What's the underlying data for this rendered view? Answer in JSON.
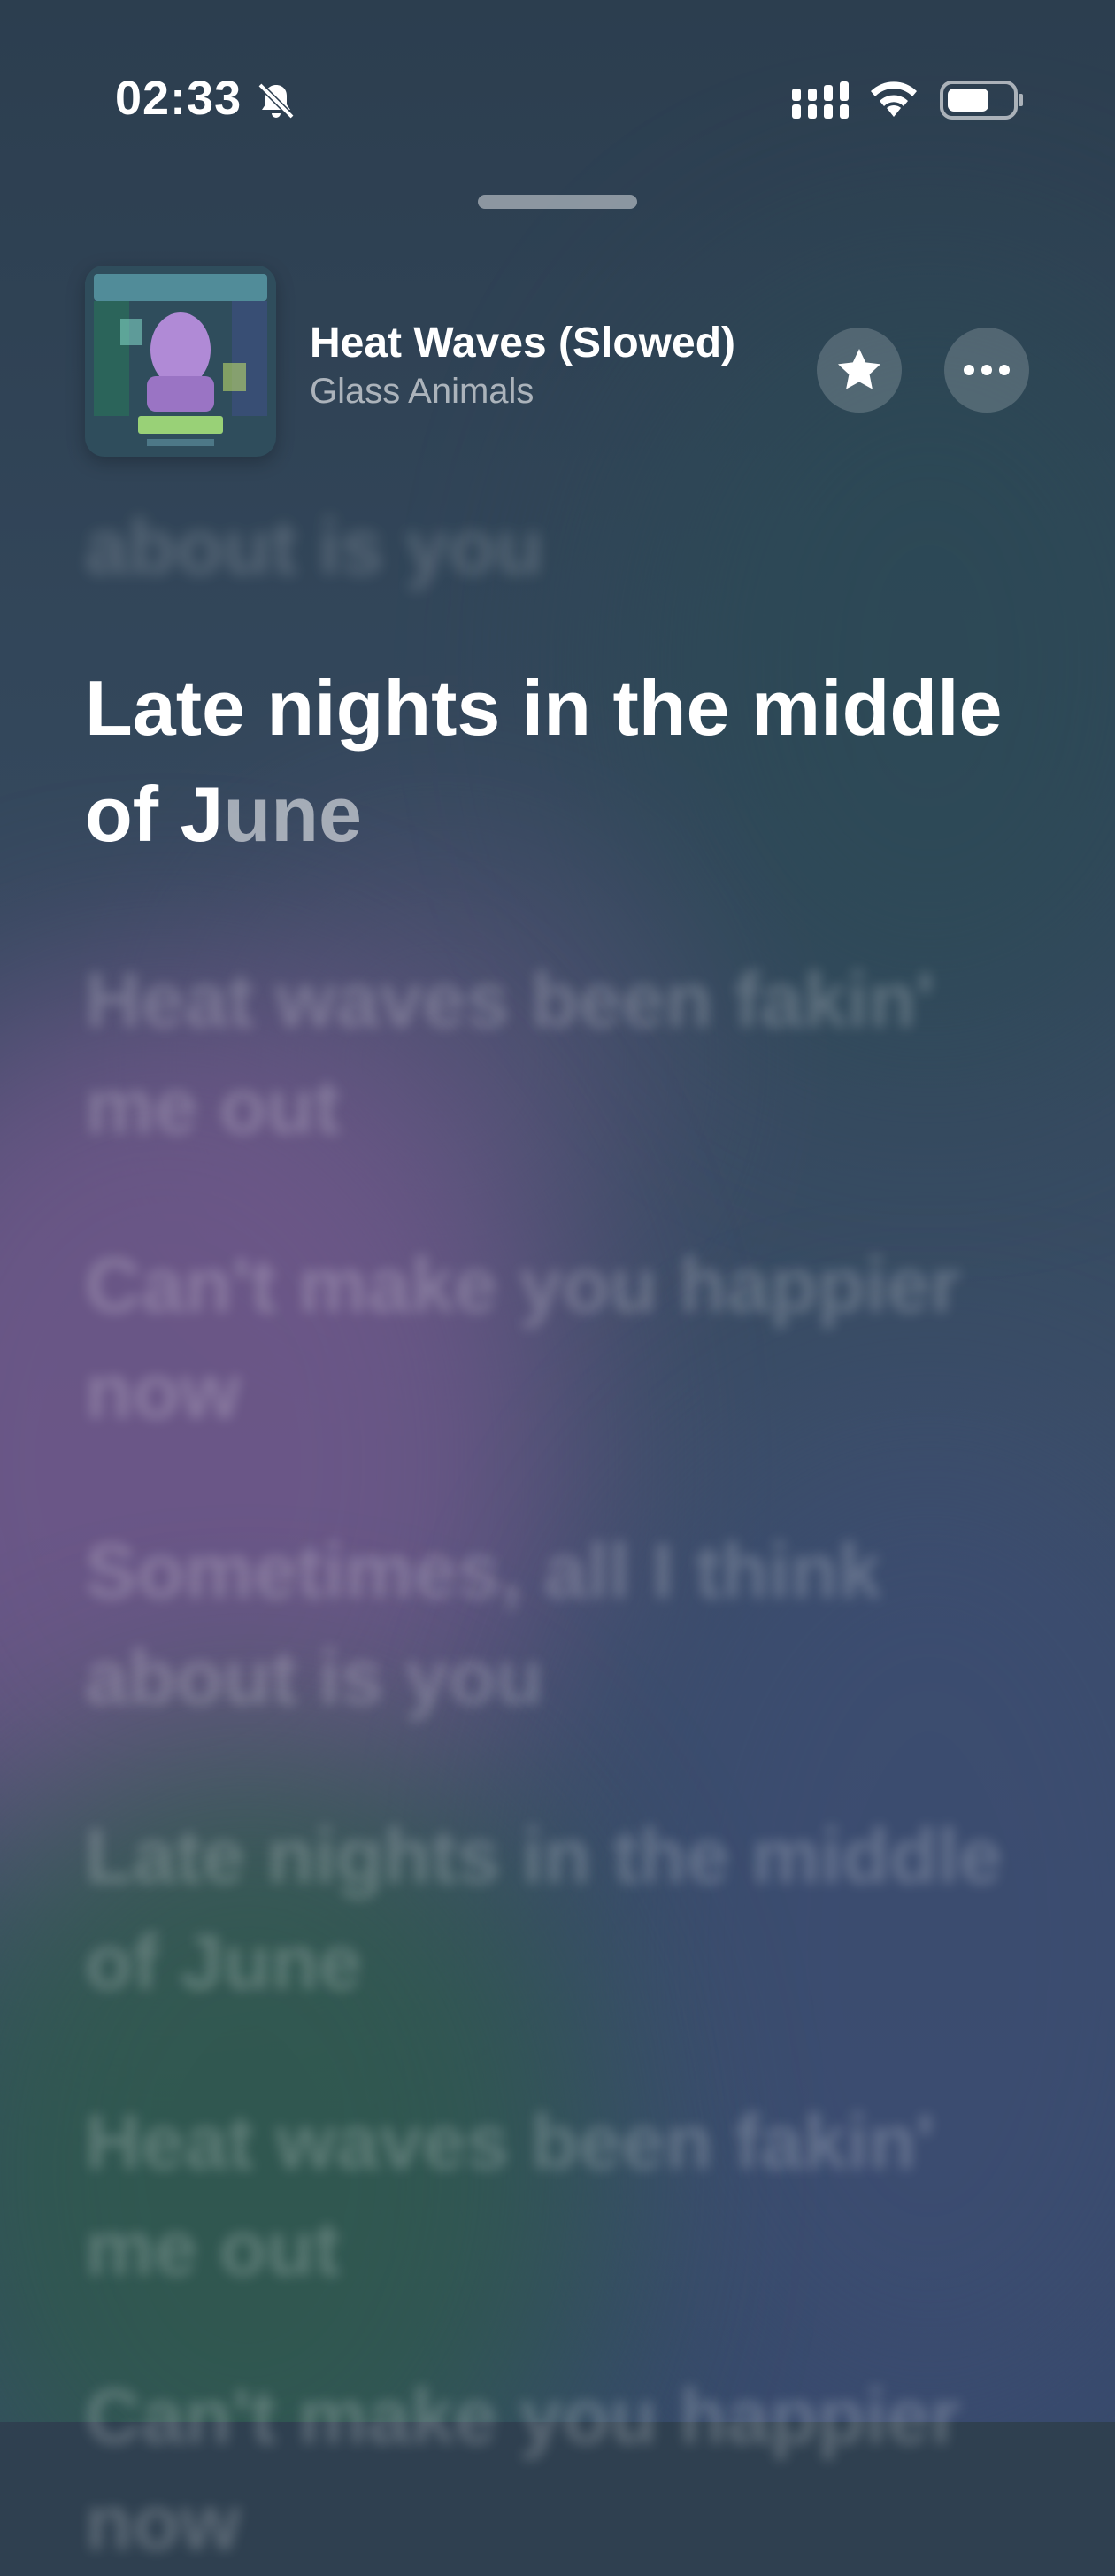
{
  "status_bar": {
    "time": "02:33"
  },
  "now_playing": {
    "title": "Heat Waves (Slowed)",
    "artist": "Glass Animals",
    "cover_icon": "album-cover"
  },
  "lyrics": {
    "previous": "about is you",
    "active_sung": "Late nights in the middle of J",
    "active_unsung": "une",
    "upcoming": [
      "Heat waves been fakin' me out",
      "Can't make you happier now",
      "Sometimes, all I think about is you",
      "Late nights in the middle of June",
      "Heat waves been fakin' me out",
      "Can't make you happier now"
    ]
  }
}
